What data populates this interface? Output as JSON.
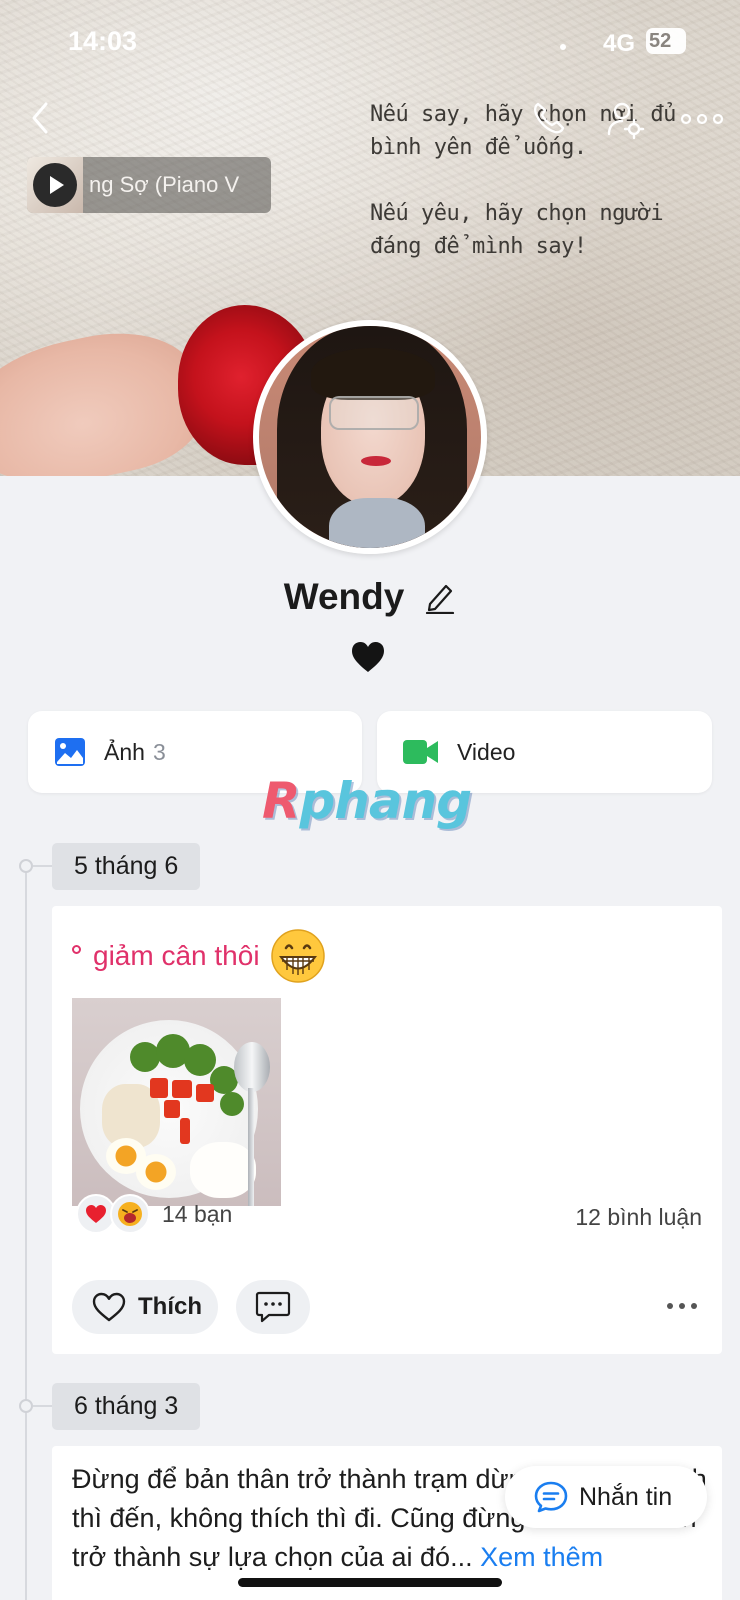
{
  "status_bar": {
    "time": "14:03",
    "network": "4G",
    "battery": "52"
  },
  "cover": {
    "quote_paragraph_1": "Nếu say, hãy chọn nơi đủ\nbình yên để uống.",
    "quote_paragraph_2": "Nếu yêu, hãy chọn người\nđáng để mình say!"
  },
  "top_bar": {
    "back_icon": "chevron-left-icon",
    "call_icon": "phone-icon",
    "settings_icon": "user-settings-icon",
    "more_icon": "more-horizontal-icon"
  },
  "music": {
    "title": "ng Sợ (Piano V"
  },
  "profile": {
    "name": "Wendy",
    "bio": "🖤"
  },
  "media": {
    "photos_label": "Ảnh",
    "photos_count": "3",
    "video_label": "Video"
  },
  "watermark": {
    "first_letter": "R",
    "rest": "phang"
  },
  "timeline": [
    {
      "date": "5 tháng 6",
      "caption": "giảm cân thôi",
      "reactions_count": "14 bạn",
      "comments_count": "12 bình luận",
      "like_label": "Thích"
    },
    {
      "date": "6 tháng 3",
      "text": "Đừng để bản thân trở thành trạm dừng chân, ai thích thì đến, không thích thì đi. Cũng đừng biến bản thân trở thành sự lựa chọn của ai đó...",
      "see_more": "Xem thêm"
    }
  ],
  "message_button": {
    "label": "Nhắn tin"
  },
  "colors": {
    "accent_blue": "#1a7ef0",
    "caption_pink": "#e0316a",
    "video_green": "#2dbb5d",
    "background": "#f1f2f5"
  }
}
